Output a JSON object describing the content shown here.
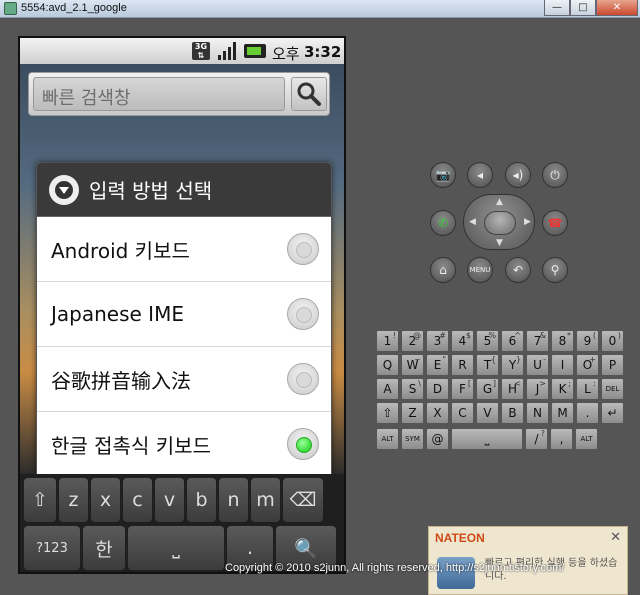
{
  "window": {
    "title": "5554:avd_2.1_google",
    "minimize_icon": "minimize-icon",
    "maximize_icon": "maximize-icon",
    "close_icon": "close-icon"
  },
  "statusbar": {
    "network": "3G",
    "ampm": "오후",
    "time": "3:32"
  },
  "search": {
    "placeholder": "빠른 검색창"
  },
  "dialog": {
    "title": "입력 방법 선택",
    "options": [
      {
        "label": "Android 키보드",
        "selected": false
      },
      {
        "label": "Japanese IME",
        "selected": false
      },
      {
        "label": "谷歌拼音输入法",
        "selected": false
      },
      {
        "label": "한글 접촉식 키보드",
        "selected": true
      }
    ]
  },
  "soft_keyboard": {
    "row1": [
      "⇧",
      "z",
      "x",
      "c",
      "v",
      "b",
      "n",
      "m",
      "⌫"
    ],
    "row2": [
      "?123",
      "한",
      "⎵",
      ".",
      "🔍"
    ]
  },
  "emulator_controls": {
    "top_row": [
      "camera-icon",
      "volume-down-icon",
      "volume-up-icon",
      "power-icon"
    ],
    "bottom_row": [
      "home-icon",
      "menu-button",
      "back-icon",
      "search-icon"
    ],
    "menu_label": "MENU"
  },
  "hw_keyboard": {
    "row1": [
      [
        "1",
        "!"
      ],
      [
        "2",
        "@"
      ],
      [
        "3",
        "#"
      ],
      [
        "4",
        "$"
      ],
      [
        "5",
        "%"
      ],
      [
        "6",
        "^"
      ],
      [
        "7",
        "&"
      ],
      [
        "8",
        "*"
      ],
      [
        "9",
        "("
      ],
      [
        "0",
        ")"
      ]
    ],
    "row2": [
      [
        "Q",
        ""
      ],
      [
        "W",
        "~"
      ],
      [
        "E",
        "\""
      ],
      [
        "R",
        ""
      ],
      [
        "T",
        "{"
      ],
      [
        "Y",
        "}"
      ],
      [
        "U",
        "-"
      ],
      [
        "I",
        ""
      ],
      [
        "O",
        "+"
      ],
      [
        "P",
        ""
      ]
    ],
    "row3": [
      [
        "A",
        ""
      ],
      [
        "S",
        "\\"
      ],
      [
        "D",
        ""
      ],
      [
        "F",
        "["
      ],
      [
        "G",
        "]"
      ],
      [
        "H",
        "<"
      ],
      [
        "J",
        ">"
      ],
      [
        "K",
        ";"
      ],
      [
        "L",
        ":"
      ],
      [
        "DEL",
        ""
      ]
    ],
    "row4": [
      [
        "⇧",
        ""
      ],
      [
        "Z",
        ""
      ],
      [
        "X",
        ""
      ],
      [
        "C",
        ""
      ],
      [
        "V",
        ""
      ],
      [
        "B",
        ""
      ],
      [
        "N",
        ""
      ],
      [
        "M",
        ""
      ],
      [
        ".",
        ""
      ],
      [
        "↵",
        ""
      ]
    ],
    "row5": [
      [
        "ALT",
        ""
      ],
      [
        "SYM",
        ""
      ],
      [
        "@",
        ""
      ],
      [
        "⎵",
        ""
      ],
      [
        "/",
        "?"
      ],
      [
        ",",
        ""
      ],
      [
        "ALT",
        ""
      ]
    ]
  },
  "nateon": {
    "brand": "NATEON",
    "message": "빠르고 편리한 실행 등을 하셨습니다."
  },
  "copyright": "Copyright © 2010 s2junn, All rights reserved, http://s2junn.tistory.com/"
}
